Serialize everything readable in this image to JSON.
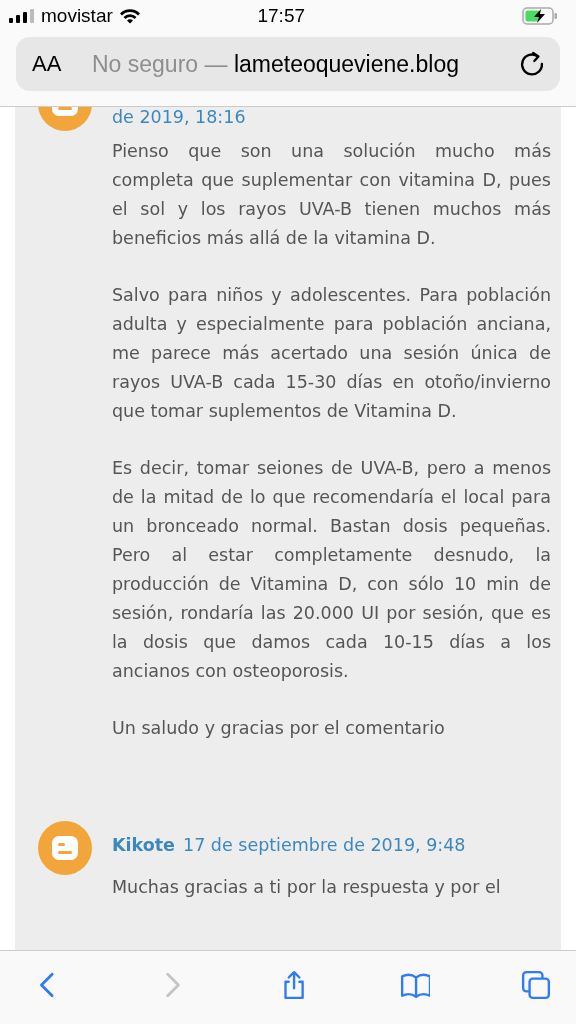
{
  "status_bar": {
    "carrier": "movistar",
    "time": "17:57"
  },
  "address_bar": {
    "text_size_label": "AA",
    "security": "No seguro —",
    "domain": "lameteoqueviene.blog"
  },
  "comments": [
    {
      "date": "de 2019, 18:16",
      "paragraphs": [
        "Pienso que son una solución mucho más completa que suplementar con vitamina D, pues el sol y los rayos UVA-B tienen muchos más beneficios más allá de la vitamina D.",
        "Salvo para niños y adolescentes. Para población adulta y especialmente para población anciana, me parece más acertado una sesión única de rayos UVA-B cada 15-30 días en otoño/invierno que tomar suplementos de Vitamina D.",
        "Es decir, tomar seiones de UVA-B, pero a menos de la mitad de lo que recomendaría el local para un bronceado normal. Bastan dosis pequeñas. Pero al estar completamente desnudo, la producción de Vitamina D, con sólo 10 min de sesión, rondaría las 20.000 UI por sesión, que es la dosis que damos cada 10-15 días a los ancianos con osteoporosis.",
        "Un saludo y gracias por el comentario"
      ]
    },
    {
      "author": "Kikote",
      "date": "17 de septiembre de 2019, 9:48",
      "paragraphs": [
        "Muchas gracias a ti por la respuesta y por el"
      ]
    }
  ],
  "toolbar": [
    {
      "kind": "back",
      "disabled": false
    },
    {
      "kind": "forward",
      "disabled": true
    },
    {
      "kind": "share",
      "disabled": false
    },
    {
      "kind": "bookmarks",
      "disabled": false
    },
    {
      "kind": "tabs",
      "disabled": false
    }
  ]
}
